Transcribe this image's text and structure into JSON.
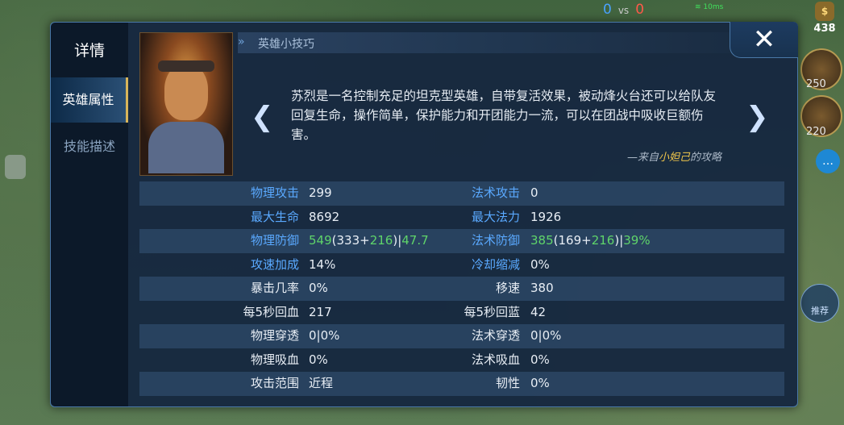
{
  "hud": {
    "score_blue": "0",
    "score_vs": "vs",
    "score_red": "0",
    "ping": "10ms",
    "gold": "438",
    "item_prices": [
      "250",
      "220"
    ],
    "recommend_label": "推荐"
  },
  "panel": {
    "title": "详情",
    "tabs": [
      {
        "label": "英雄属性",
        "active": true
      },
      {
        "label": "技能描述",
        "active": false
      }
    ],
    "tips_header": "英雄小技巧",
    "tip_text": "苏烈是一名控制充足的坦克型英雄，自带复活效果，被动烽火台还可以给队友回复生命，操作简单，保护能力和开团能力一流，可以在团战中吸收巨额伤害。",
    "credit_prefix": "—来自",
    "credit_author": "小妲己",
    "credit_suffix": "的攻略",
    "close_glyph": "✕",
    "prev_glyph": "❮",
    "next_glyph": "❯"
  },
  "stats": [
    {
      "l1": "物理攻击",
      "v1": "299",
      "l2": "法术攻击",
      "v2": "0",
      "blue": true
    },
    {
      "l1": "最大生命",
      "v1": "8692",
      "l2": "最大法力",
      "v2": "1926",
      "blue": true
    },
    {
      "l1": "物理防御",
      "v1a": "549",
      "v1b": "(333+",
      "v1c": "216",
      "v1d": ")|",
      "v1e": "47.7",
      "l2": "法术防御",
      "v2a": "385",
      "v2b": "(169+",
      "v2c": "216",
      "v2d": ")|",
      "v2e": "39%",
      "blue": true,
      "composite": true
    },
    {
      "l1": "攻速加成",
      "v1": "14%",
      "l2": "冷却缩减",
      "v2": "0%",
      "blue": true
    },
    {
      "l1": "暴击几率",
      "v1": "0%",
      "l2": "移速",
      "v2": "380",
      "blue": false
    },
    {
      "l1": "每5秒回血",
      "v1": "217",
      "l2": "每5秒回蓝",
      "v2": "42",
      "blue": false
    },
    {
      "l1": "物理穿透",
      "v1": "0|0%",
      "l2": "法术穿透",
      "v2": "0|0%",
      "blue": false
    },
    {
      "l1": "物理吸血",
      "v1": "0%",
      "l2": "法术吸血",
      "v2": "0%",
      "blue": false
    },
    {
      "l1": "攻击范围",
      "v1": "近程",
      "l2": "韧性",
      "v2": "0%",
      "blue": false
    }
  ]
}
